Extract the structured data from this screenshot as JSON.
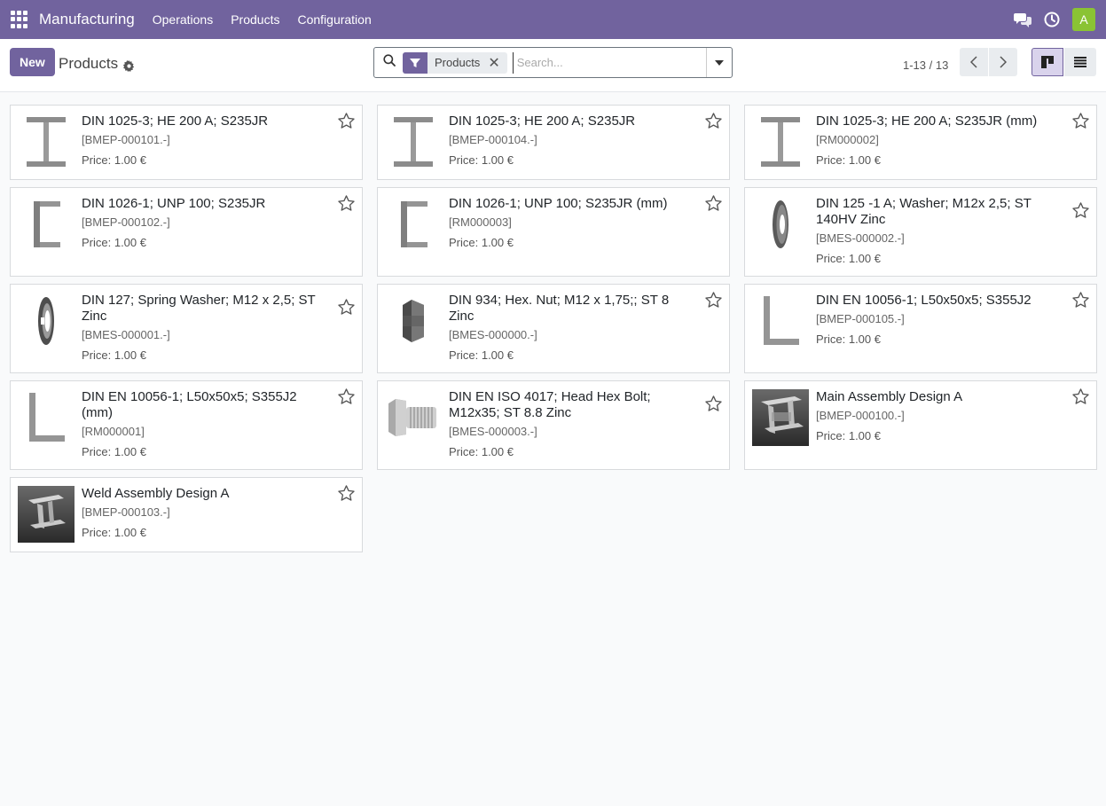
{
  "navbar": {
    "brand": "Manufacturing",
    "menu": [
      "Operations",
      "Products",
      "Configuration"
    ],
    "avatar_letter": "A"
  },
  "control": {
    "new_label": "New",
    "title": "Products",
    "facet_label": "Products",
    "search_placeholder": "Search...",
    "pager_text": "1-13 / 13"
  },
  "products": [
    {
      "name": "DIN 1025-3; HE 200 A; S235JR",
      "ref": "[BMEP-000101.-]",
      "price": "Price: 1.00 €",
      "icon": "i-beam-icon"
    },
    {
      "name": "DIN 1025-3; HE 200 A; S235JR",
      "ref": "[BMEP-000104.-]",
      "price": "Price: 1.00 €",
      "icon": "i-beam-icon"
    },
    {
      "name": "DIN 1025-3; HE 200 A; S235JR (mm)",
      "ref": "[RM000002]",
      "price": "Price: 1.00 €",
      "icon": "i-beam-icon"
    },
    {
      "name": "DIN 1026-1; UNP 100; S235JR",
      "ref": "[BMEP-000102.-]",
      "price": "Price: 1.00 €",
      "icon": "u-channel-icon"
    },
    {
      "name": "DIN 1026-1; UNP 100; S235JR (mm)",
      "ref": "[RM000003]",
      "price": "Price: 1.00 €",
      "icon": "u-channel-icon"
    },
    {
      "name": "DIN 125 -1 A; Washer; M12x 2,5; ST 140HV Zinc",
      "ref": "[BMES-000002.-]",
      "price": "Price: 1.00 €",
      "icon": "washer-icon"
    },
    {
      "name": "DIN 127; Spring Washer; M12 x 2,5; ST Zinc",
      "ref": "[BMES-000001.-]",
      "price": "Price: 1.00 €",
      "icon": "spring-washer-icon"
    },
    {
      "name": "DIN 934; Hex. Nut; M12 x 1,75;; ST 8 Zinc",
      "ref": "[BMES-000000.-]",
      "price": "Price: 1.00 €",
      "icon": "hex-nut-icon"
    },
    {
      "name": "DIN EN 10056-1; L50x50x5; S355J2",
      "ref": "[BMEP-000105.-]",
      "price": "Price: 1.00 €",
      "icon": "angle-profile-icon"
    },
    {
      "name": "DIN EN 10056-1; L50x50x5; S355J2 (mm)",
      "ref": "[RM000001]",
      "price": "Price: 1.00 €",
      "icon": "angle-profile-icon"
    },
    {
      "name": "DIN EN ISO 4017; Head Hex Bolt; M12x35; ST 8.8 Zinc",
      "ref": "[BMES-000003.-]",
      "price": "Price: 1.00 €",
      "icon": "hex-bolt-icon"
    },
    {
      "name": "Main Assembly Design A",
      "ref": "[BMEP-000100.-]",
      "price": "Price: 1.00 €",
      "icon": "assembly-render-icon"
    },
    {
      "name": "Weld Assembly Design A",
      "ref": "[BMEP-000103.-]",
      "price": "Price: 1.00 €",
      "icon": "weld-assembly-icon"
    }
  ]
}
